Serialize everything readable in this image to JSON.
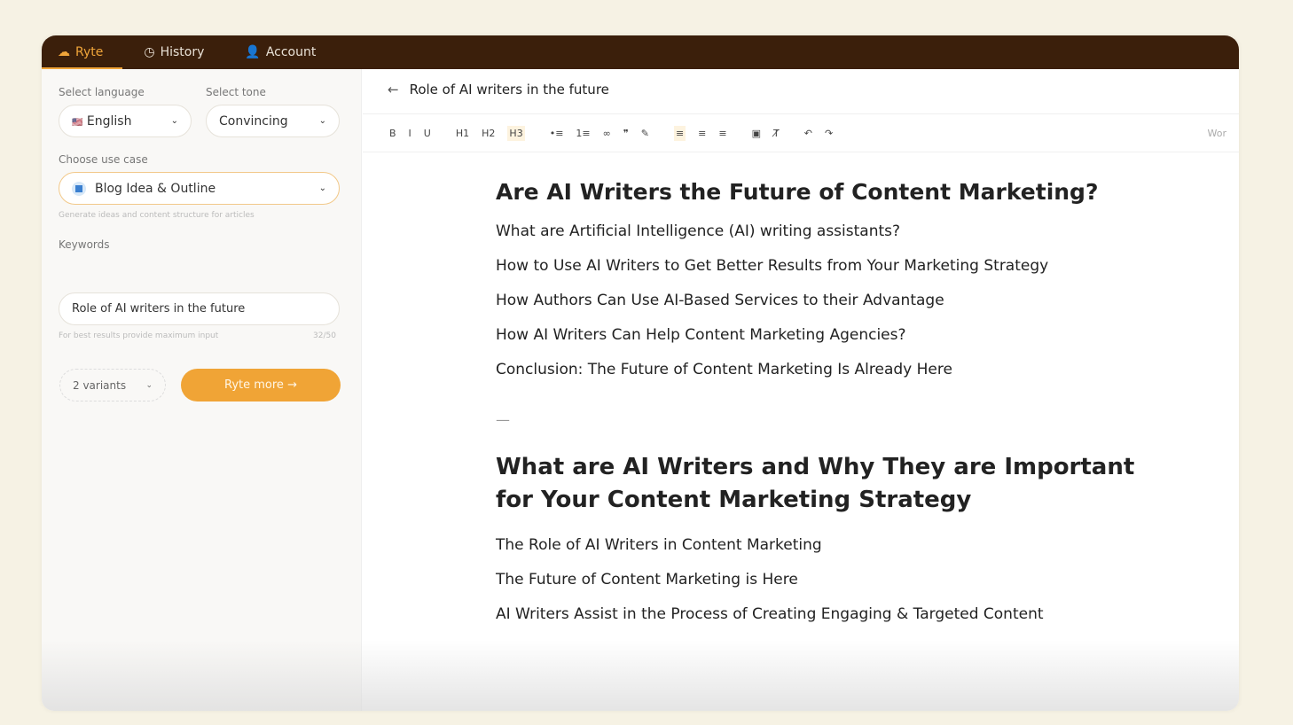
{
  "nav": {
    "tabs": [
      {
        "label": "Ryte",
        "icon": "ryte-logo-icon"
      },
      {
        "label": "History",
        "icon": "history-icon"
      },
      {
        "label": "Account",
        "icon": "user-icon"
      }
    ],
    "accent": "#f0a436"
  },
  "sidebar": {
    "language_label": "Select language",
    "language_value": "English",
    "language_flag": "🇺🇸",
    "tone_label": "Select tone",
    "tone_value": "Convincing",
    "usecase_label": "Choose use case",
    "usecase_value": "Blog Idea & Outline",
    "usecase_hint": "Generate ideas and content structure for articles",
    "keywords_label": "Keywords",
    "keywords_value": "Role of AI writers in the future",
    "keywords_hint": "For best results provide maximum input",
    "keywords_count": "32/50",
    "variants_value": "2 variants",
    "submit_label": "Ryte more →"
  },
  "editor": {
    "title": "Role of AI writers in the future",
    "toolbar": [
      "B",
      "I",
      "U",
      "H1",
      "H2",
      "H3",
      "•≡",
      "1≡",
      "∞",
      "❞",
      "✎",
      "≡",
      "≡",
      "≡",
      "▣",
      "T̸",
      "↶",
      "↷"
    ],
    "word_label": "Wor",
    "h1": "Are AI Writers the Future of Content Marketing?",
    "list1": [
      "What are Artificial Intelligence (AI) writing assistants?",
      "How to Use AI Writers to Get Better Results from Your Marketing Strategy",
      "How Authors Can Use AI-Based Services to their Advantage",
      "How AI Writers Can Help Content Marketing Agencies?",
      "Conclusion: The Future of Content Marketing Is Already Here"
    ],
    "separator": "—",
    "h2": "What are AI Writers and Why They are Important for Your Content Marketing Strategy",
    "list2": [
      "The Role of AI Writers in Content Marketing",
      "The Future of Content Marketing is Here",
      "AI Writers Assist in the Process of Creating Engaging & Targeted Content"
    ]
  }
}
